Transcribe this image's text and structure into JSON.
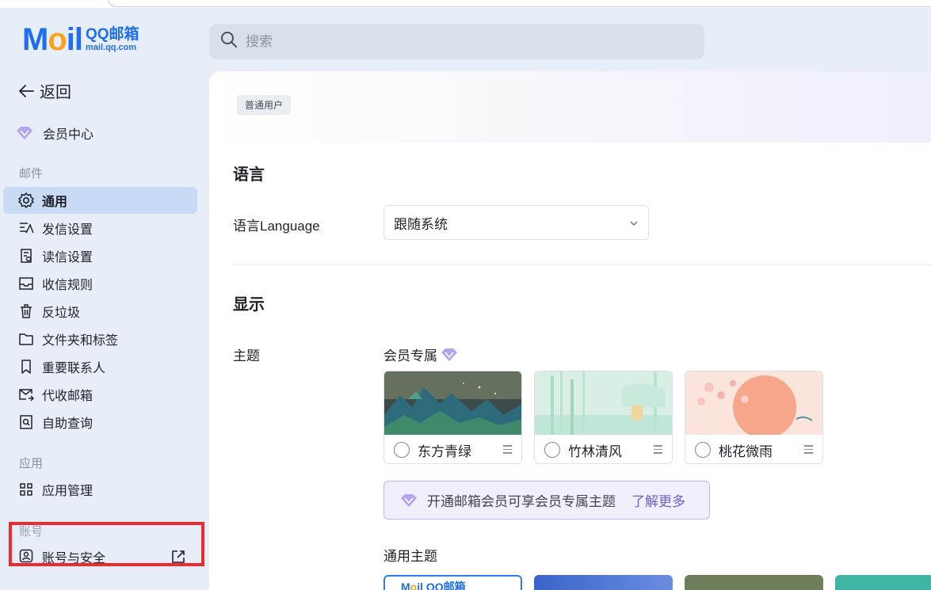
{
  "logo": {
    "mail_text": "M",
    "mail_o": "o",
    "mail_il": "il",
    "brand": "QQ邮箱",
    "url": "mail.qq.com"
  },
  "search": {
    "placeholder": "搜索"
  },
  "sidebar": {
    "back_label": "返回",
    "vip_label": "会员中心",
    "section_mail": "邮件",
    "items": [
      {
        "label": "通用",
        "icon": "gear-icon",
        "active": true
      },
      {
        "label": "发信设置",
        "icon": "send-settings-icon"
      },
      {
        "label": "读信设置",
        "icon": "read-settings-icon"
      },
      {
        "label": "收信规则",
        "icon": "inbox-rule-icon"
      },
      {
        "label": "反垃圾",
        "icon": "trash-icon"
      },
      {
        "label": "文件夹和标签",
        "icon": "folder-icon"
      },
      {
        "label": "重要联系人",
        "icon": "bookmark-icon"
      },
      {
        "label": "代收邮箱",
        "icon": "mail-collect-icon"
      },
      {
        "label": "自助查询",
        "icon": "self-query-icon"
      }
    ],
    "section_app": "应用",
    "app_items": [
      {
        "label": "应用管理",
        "icon": "grid-icon"
      }
    ],
    "section_account": "账号",
    "account_items": [
      {
        "label": "账号与安全",
        "icon": "user-shield-icon",
        "external": "external-link-icon"
      }
    ]
  },
  "main": {
    "badge": "普通用户",
    "language_section": "语言",
    "language_label": "语言Language",
    "language_value": "跟随系统",
    "display_section": "显示",
    "theme_label": "主题",
    "vip_themes_label": "会员专属",
    "vip_themes": [
      {
        "name": "东方青绿"
      },
      {
        "name": "竹林清风"
      },
      {
        "name": "桃花微雨"
      }
    ],
    "promo_text": "开通邮箱会员可享会员专属主题",
    "promo_link": "了解更多",
    "general_themes_label": "通用主题"
  },
  "colors": {
    "accent": "#1d6ef2",
    "vip_purple": "#9b86e8",
    "highlight_red": "#ee2a2f"
  }
}
